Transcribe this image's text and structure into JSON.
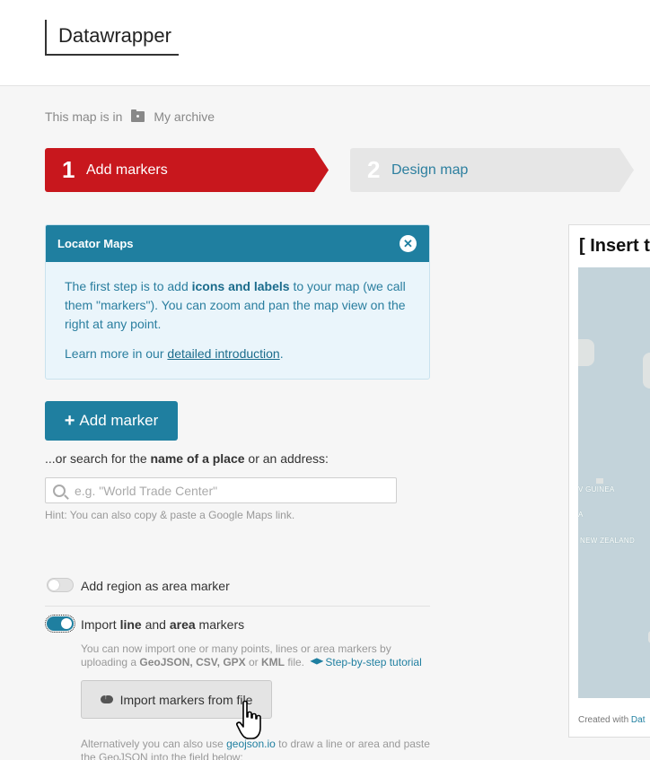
{
  "app": {
    "logo": "Datawrapper"
  },
  "breadcrumb": {
    "prefix": "This map is in",
    "folder": "My archive"
  },
  "steps": [
    {
      "number": "1",
      "label": "Add markers",
      "active": true
    },
    {
      "number": "2",
      "label": "Design map",
      "active": false
    }
  ],
  "info_box": {
    "title": "Locator Maps",
    "close": "✕",
    "text_before": "The first step is to add ",
    "text_bold": "icons and labels",
    "text_after": " to your map (we call them \"markers\"). You can zoom and pan the map view on the right at any point.",
    "learn_prefix": "Learn more in our ",
    "learn_link": "detailed introduction",
    "learn_suffix": "."
  },
  "add_marker": {
    "icon": "+",
    "label": "Add marker"
  },
  "search": {
    "label_prefix": "...or search for the ",
    "label_bold": "name of a place",
    "label_suffix": " or an address:",
    "placeholder": "e.g. \"World Trade Center\"",
    "hint": "Hint: You can also copy & paste a Google Maps link."
  },
  "region_toggle": {
    "label": "Add region as area marker",
    "on": false
  },
  "import_toggle": {
    "label_prefix": "Import ",
    "label_bold1": "line",
    "label_mid": " and ",
    "label_bold2": "area",
    "label_suffix": " markers",
    "on": true
  },
  "import_desc": {
    "line1": "You can now import one or many points, lines or area markers by uploading a ",
    "formats": "GeoJSON, CSV, GPX",
    "or": " or ",
    "kml": "KML",
    "file": " file.",
    "tutorial": "Step-by-step tutorial"
  },
  "import_button": {
    "label": "Import markers from file"
  },
  "alt_text": {
    "prefix": "Alternatively you can also use ",
    "link": "geojson.io",
    "suffix": " to draw a line or area and paste the GeoJSON into the field below:"
  },
  "preview": {
    "title": "[ Insert t",
    "labels": [
      "V GUINEA",
      "A",
      "NEW ZEALAND"
    ],
    "credit_prefix": "Created with ",
    "credit_link": "Dat"
  },
  "colors": {
    "accent": "#c8171d",
    "primary": "#1f7fa0"
  }
}
